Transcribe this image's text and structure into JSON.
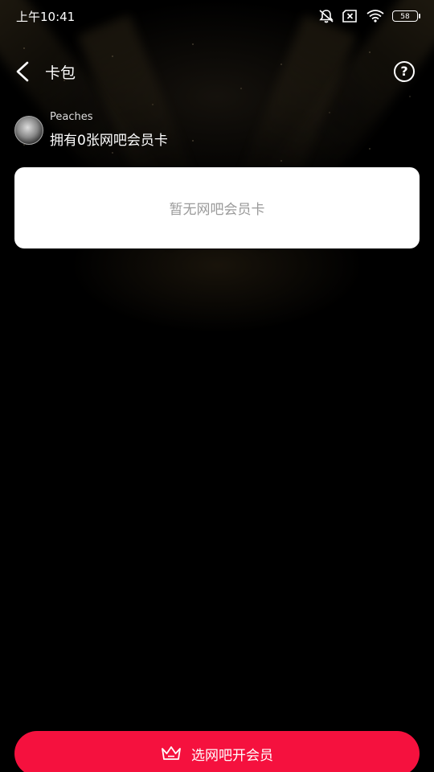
{
  "status_bar": {
    "time": "上午10:41",
    "battery": "58",
    "icons": [
      "mute-icon",
      "sim-x-icon",
      "wifi-icon",
      "battery-icon"
    ]
  },
  "header": {
    "title": "卡包",
    "back_icon": "back-arrow-icon",
    "help_label": "?"
  },
  "user": {
    "name": "Peaches",
    "card_count_text": "拥有0张网吧会员卡"
  },
  "card_area": {
    "empty_text": "暂无网吧会员卡"
  },
  "footer": {
    "cta_label": "选网吧开会员",
    "cta_icon": "crown-icon",
    "cta_color": "#f5113e"
  }
}
